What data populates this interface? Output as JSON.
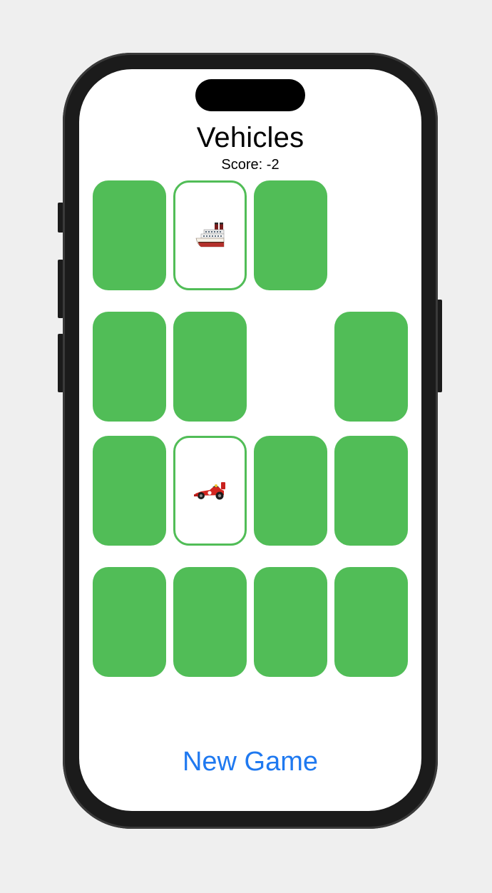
{
  "header": {
    "title": "Vehicles",
    "score": "Score: -2"
  },
  "cards": [
    {
      "state": "face-down"
    },
    {
      "state": "face-up",
      "emoji": "ship",
      "icon": "ship-icon"
    },
    {
      "state": "face-down"
    },
    {
      "state": "matched"
    },
    {
      "state": "face-down"
    },
    {
      "state": "face-down"
    },
    {
      "state": "matched"
    },
    {
      "state": "face-down"
    },
    {
      "state": "face-down"
    },
    {
      "state": "face-up",
      "emoji": "racing car",
      "icon": "racing-car-icon"
    },
    {
      "state": "face-down"
    },
    {
      "state": "face-down"
    },
    {
      "state": "face-down"
    },
    {
      "state": "face-down"
    },
    {
      "state": "face-down"
    },
    {
      "state": "face-down"
    }
  ],
  "footer": {
    "new_game_label": "New Game"
  },
  "colors": {
    "card_back": "#51bd57",
    "accent": "#1f79f0",
    "background": "#efefef"
  }
}
